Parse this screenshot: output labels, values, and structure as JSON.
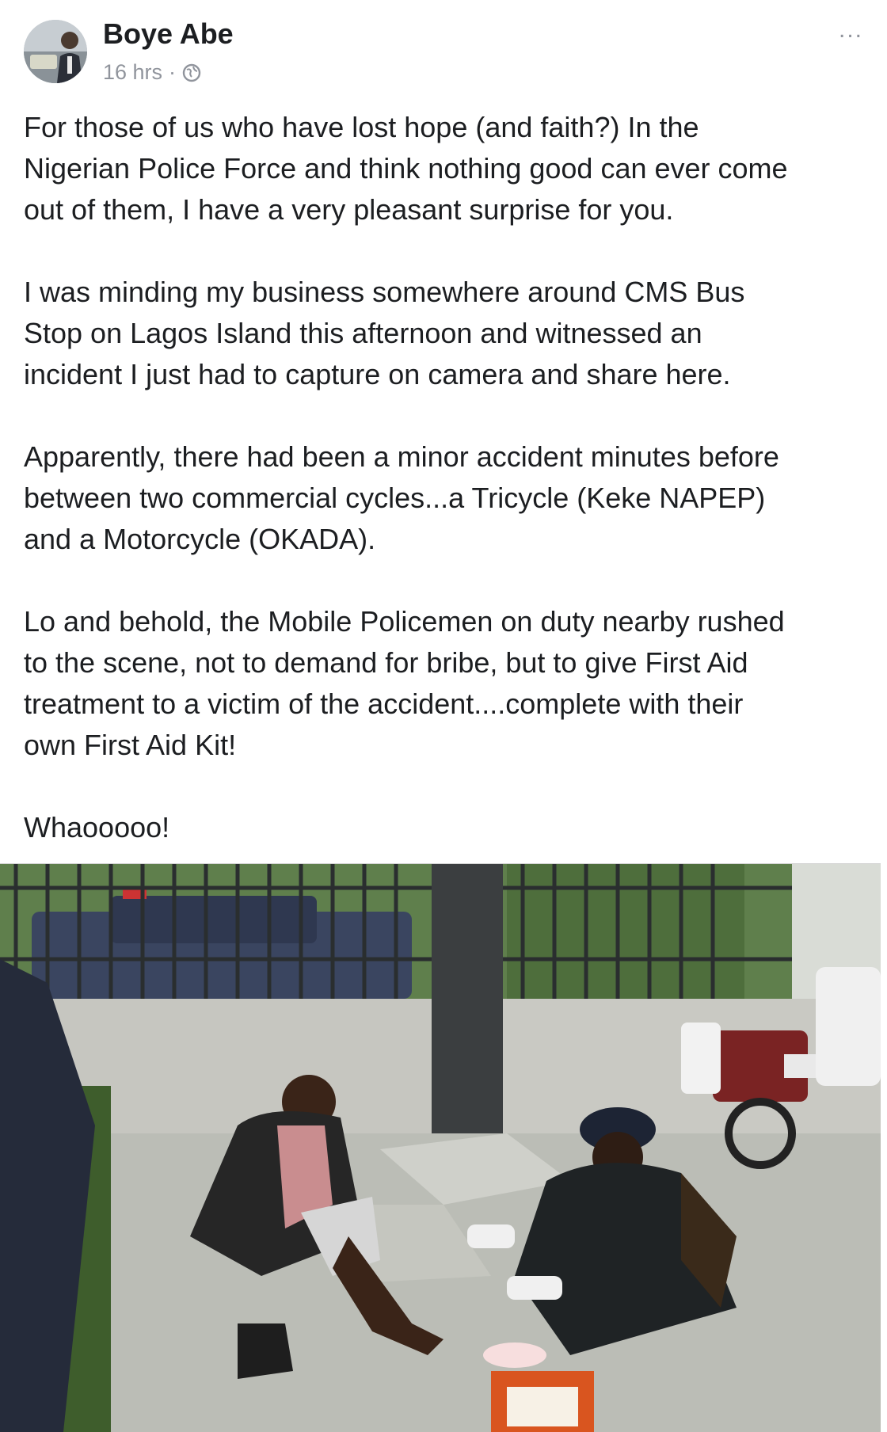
{
  "post": {
    "author": "Boye Abe",
    "timestamp": "16 hrs",
    "separator": "·",
    "privacy_icon": "globe-icon",
    "more_label": "...",
    "paragraphs": [
      "For those of us who have lost hope (and faith?) In the\nNigerian Police Force and think nothing good can ever come\nout of them, I have a very pleasant surprise for you.",
      "I was minding my business somewhere around CMS Bus\nStop on Lagos Island this afternoon  and witnessed an\nincident I just had to capture on camera and share here.",
      "Apparently, there had been a minor accident minutes before\nbetween two commercial cycles...a Tricycle (Keke NAPEP)\nand a Motorcycle (OKADA).",
      "Lo and behold, the Mobile Policemen on duty nearby rushed\nto the scene, not to demand for bribe, but to give First Aid\ntreatment to a victim of the accident....complete with their\nown First Aid Kit!",
      "Whaooooo!"
    ]
  },
  "colors": {
    "text": "#1c1e21",
    "meta": "#90949c",
    "background": "#ffffff"
  }
}
